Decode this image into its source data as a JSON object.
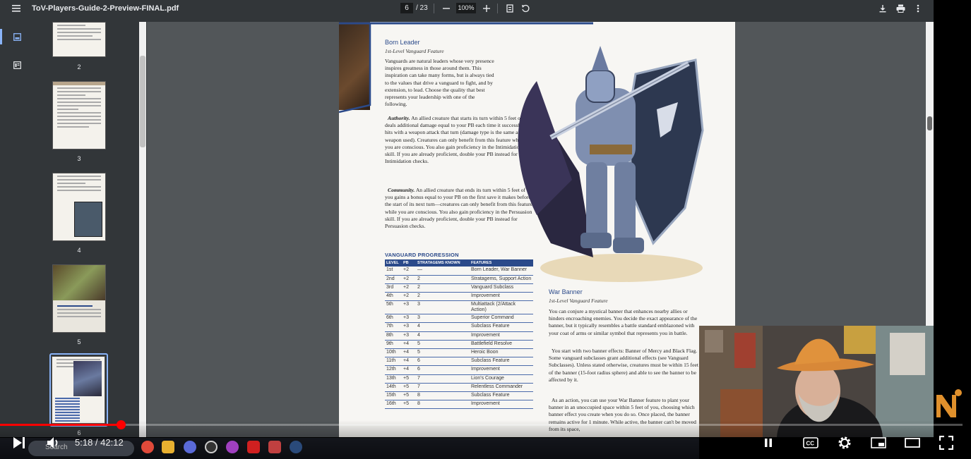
{
  "toolbar": {
    "title": "ToV-Players-Guide-2-Preview-FINAL.pdf",
    "current_page": "6",
    "total_pages": "/ 23",
    "zoom": "100%"
  },
  "sidebar": {
    "thumbnails": [
      {
        "label": "2"
      },
      {
        "label": "3"
      },
      {
        "label": "4"
      },
      {
        "label": "5"
      },
      {
        "label": "6"
      }
    ]
  },
  "page": {
    "born_leader": {
      "heading": "Born Leader",
      "subheading": "1st-Level Vanguard Feature",
      "intro": "Vanguards are natural leaders whose very presence inspires greatness in those around them. This inspiration can take many forms, but is always tied to the values that drive a vanguard to fight, and by extension, to lead. Choose the quality that best represents your leadership with one of the following.",
      "authority_label": "Authority.",
      "authority_text": "An allied creature that starts its turn within 5 feet of you deals additional damage equal to your PB each time it successfully hits with a weapon attack that turn (damage type is the same as the weapon used). Creatures can only benefit from this feature while you are conscious. You also gain proficiency in the Intimidation skill. If you are already proficient, double your PB instead for Intimidation checks.",
      "community_label": "Community.",
      "community_text": "An allied creature that ends its turn within 5 feet of you gains a bonus equal to your PB on the first save it makes before the start of its next turn—creatures can only benefit from this feature while you are conscious. You also gain proficiency in the Persuasion skill. If you are already proficient, double your PB instead for Persuasion checks."
    },
    "progression": {
      "title": "VANGUARD PROGRESSION",
      "headers": [
        "LEVEL",
        "PB",
        "STRATAGEMS KNOWN",
        "FEATURES"
      ],
      "rows": [
        [
          "1st",
          "+2",
          "—",
          "Born Leader, War Banner"
        ],
        [
          "2nd",
          "+2",
          "2",
          "Stratagems, Support Action"
        ],
        [
          "3rd",
          "+2",
          "2",
          "Vanguard Subclass"
        ],
        [
          "4th",
          "+2",
          "2",
          "Improvement"
        ],
        [
          "5th",
          "+3",
          "3",
          "Multiattack (2/Attack Action)"
        ],
        [
          "6th",
          "+3",
          "3",
          "Superior Command"
        ],
        [
          "7th",
          "+3",
          "4",
          "Subclass Feature"
        ],
        [
          "8th",
          "+3",
          "4",
          "Improvement"
        ],
        [
          "9th",
          "+4",
          "5",
          "Battlefield Resolve"
        ],
        [
          "10th",
          "+4",
          "5",
          "Heroic Boon"
        ],
        [
          "11th",
          "+4",
          "6",
          "Subclass Feature"
        ],
        [
          "12th",
          "+4",
          "6",
          "Improvement"
        ],
        [
          "13th",
          "+5",
          "7",
          "Lion's Courage"
        ],
        [
          "14th",
          "+5",
          "7",
          "Relentless Commander"
        ],
        [
          "15th",
          "+5",
          "8",
          "Subclass Feature"
        ],
        [
          "16th",
          "+5",
          "8",
          "Improvement"
        ]
      ]
    },
    "war_banner": {
      "heading": "War Banner",
      "subheading": "1st-Level Vanguard Feature",
      "p1": "You can conjure a mystical banner that enhances nearby allies or hinders encroaching enemies. You decide the exact appearance of the banner, but it typically resembles a battle standard emblazoned with your coat of arms or similar symbol that represents you in battle.",
      "p2": "You start with two banner effects: Banner of Mercy and Black Flag. Some vanguard subclasses grant additional effects (see Vanguard Subclasses). Unless stated otherwise, creatures must be within 15 feet of the banner (15-foot radius sphere) and able to see the banner to be affected by it.",
      "p3": "As an action, you can use your War Banner feature to plant your banner in an unoccupied space within 5 feet of you, choosing which banner effect you create when you do so. Once placed, the banner remains active for 1 minute. While active, the banner can't be moved from its space,"
    }
  },
  "player": {
    "time": "5:18 / 42:12",
    "progress_fraction": 0.1257
  },
  "taskbar": {
    "search_placeholder": "Search"
  },
  "colors": {
    "accent_blue": "#2b4a8a",
    "progress_red": "#ff0000",
    "viewer_bg": "#323639"
  }
}
